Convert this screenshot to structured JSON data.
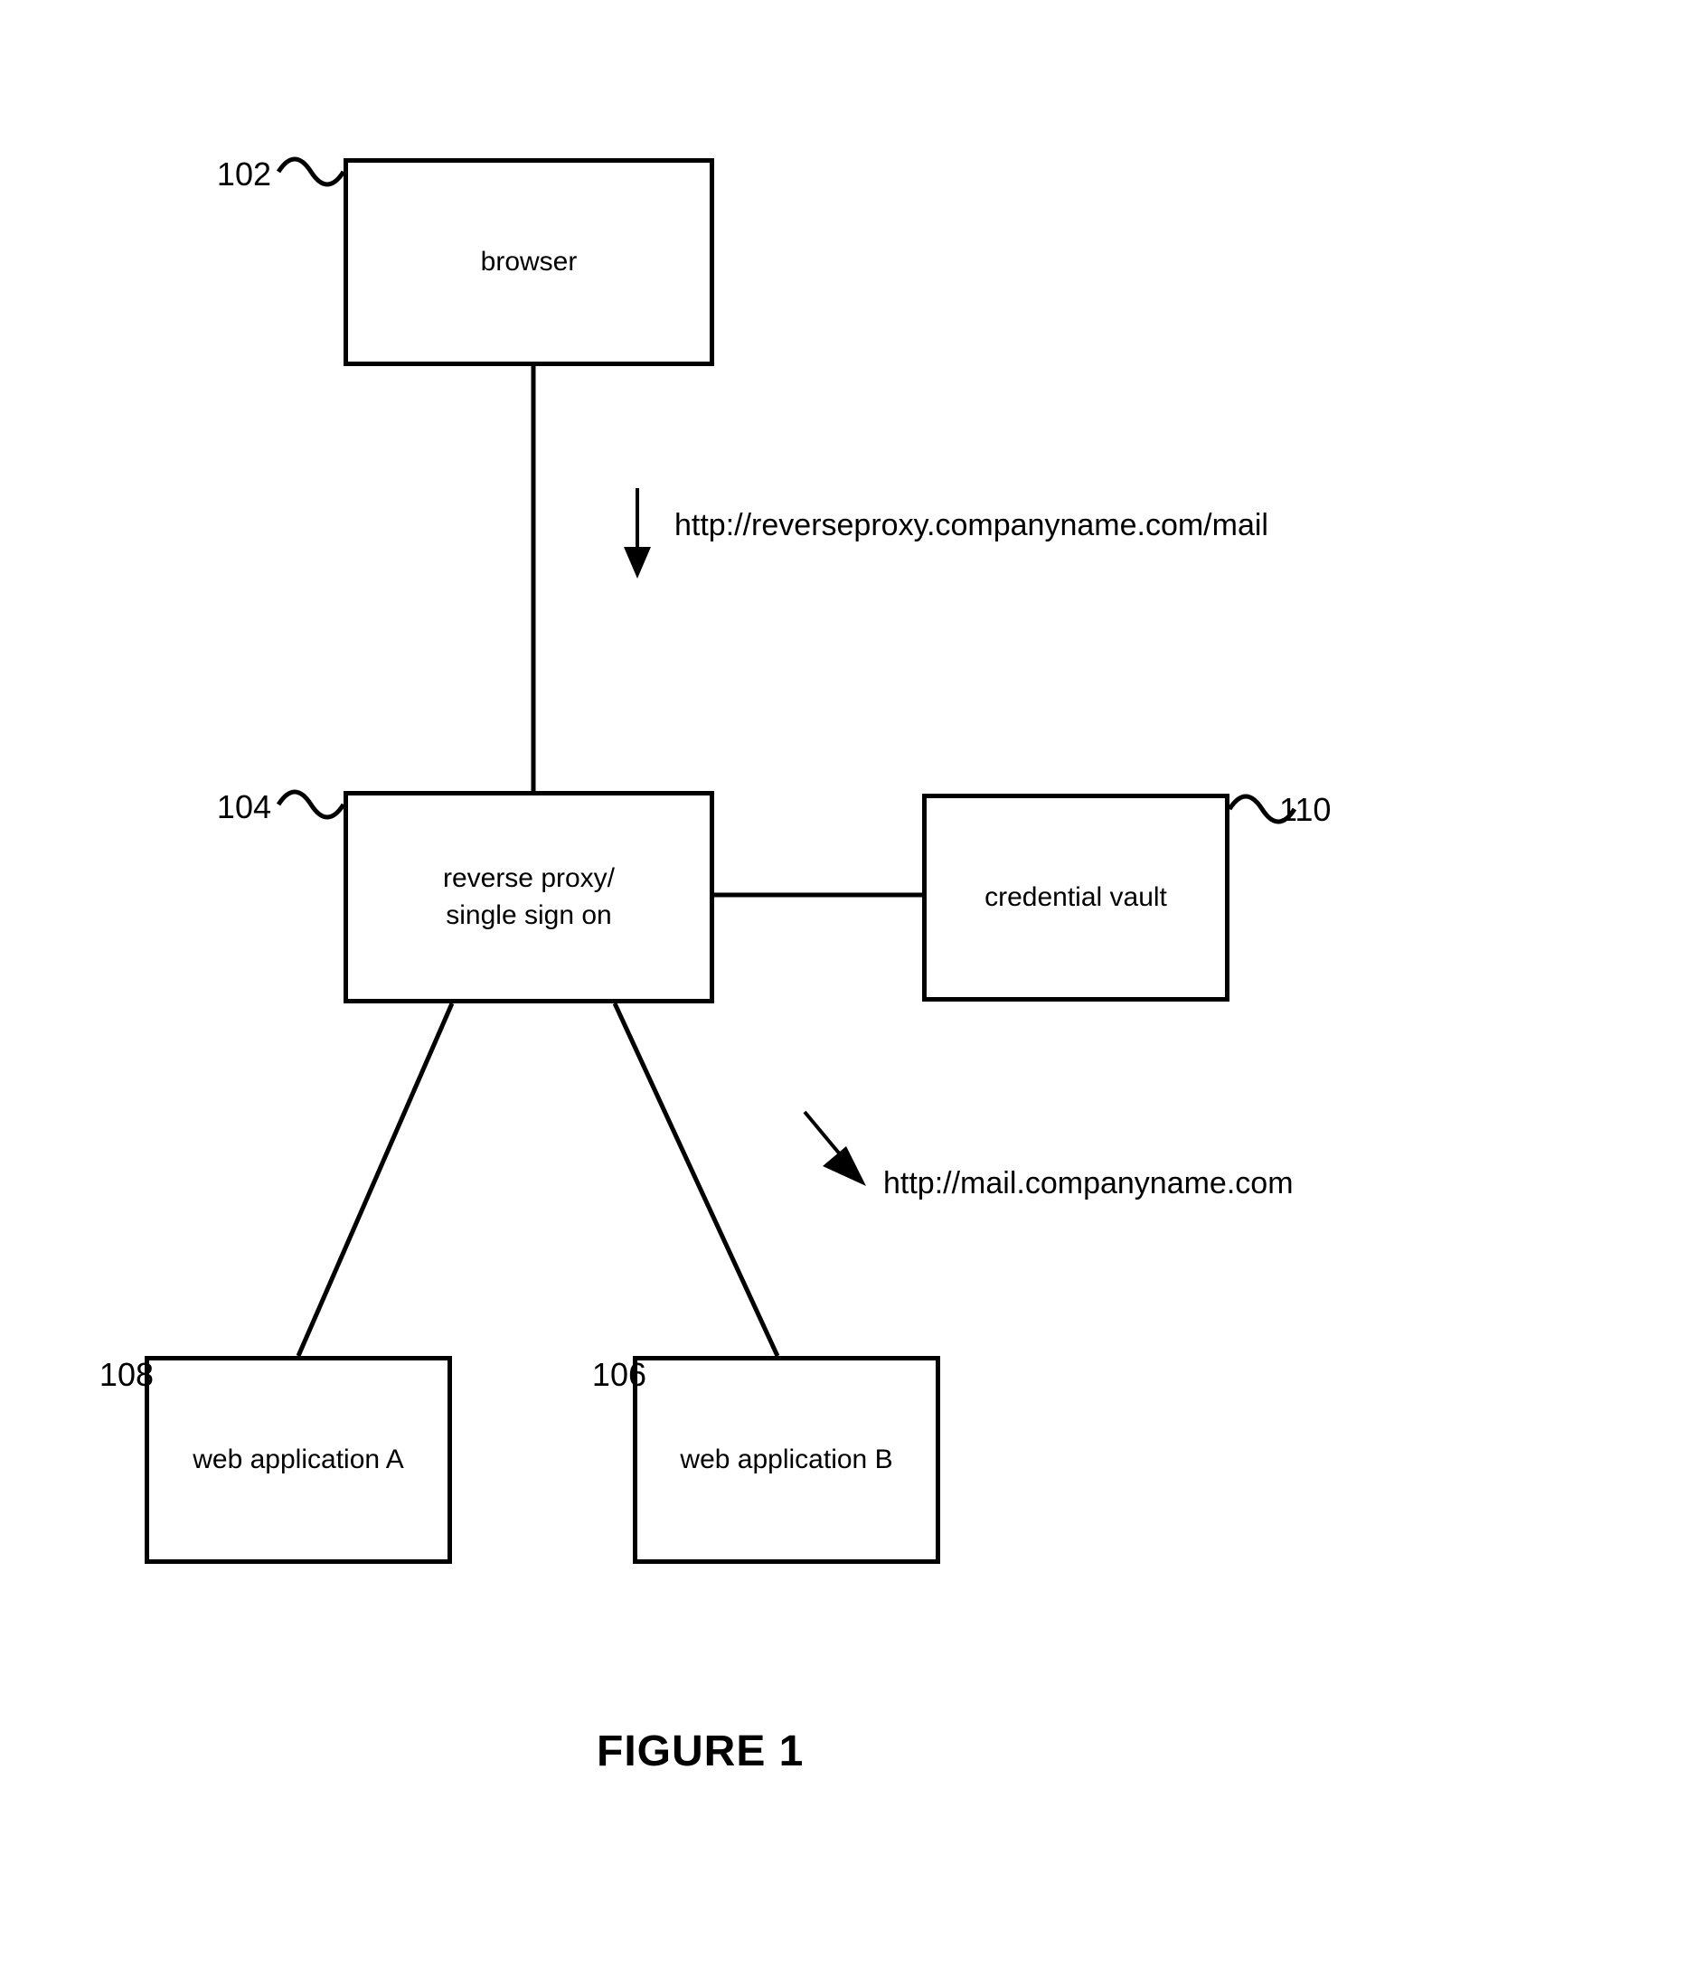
{
  "figure_caption": "FIGURE 1",
  "nodes": {
    "browser": {
      "ref": "102",
      "label": "browser"
    },
    "proxy": {
      "ref": "104",
      "label_line1": "reverse proxy/",
      "label_line2": "single sign on"
    },
    "vault": {
      "ref": "110",
      "label": "credential vault"
    },
    "appA": {
      "ref": "108",
      "label": "web application A"
    },
    "appB": {
      "ref": "106",
      "label": "web application B"
    }
  },
  "annotations": {
    "url_top": "http://reverseproxy.companyname.com/mail",
    "url_bottom": "http://mail.companyname.com"
  }
}
